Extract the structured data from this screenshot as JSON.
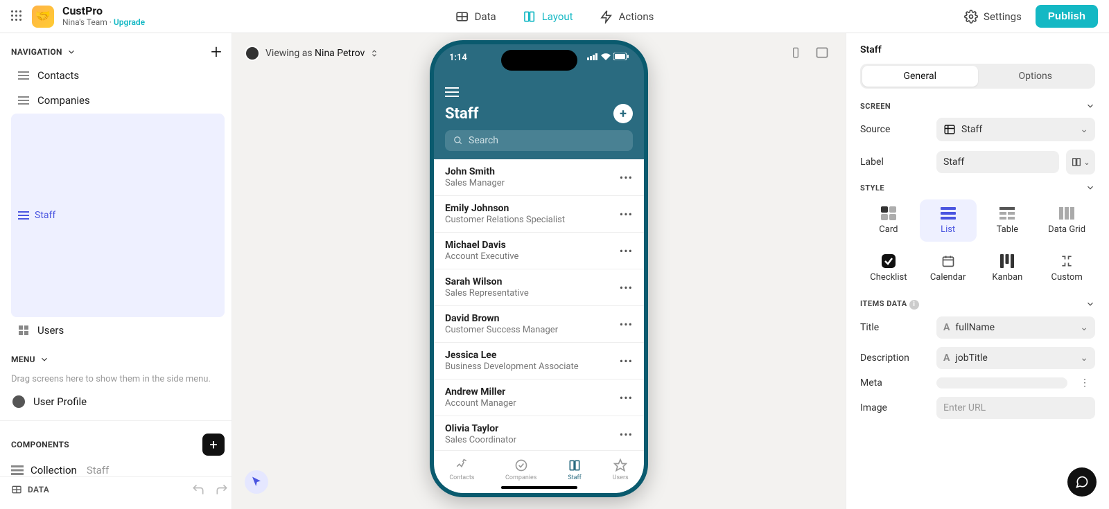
{
  "app": {
    "name": "CustPro",
    "team": "Nina's Team",
    "upgrade": "Upgrade"
  },
  "topTabs": {
    "data": "Data",
    "layout": "Layout",
    "actions": "Actions"
  },
  "topRight": {
    "settings": "Settings",
    "publish": "Publish"
  },
  "left": {
    "navHeader": "NAVIGATION",
    "navItems": [
      "Contacts",
      "Companies",
      "Staff",
      "Users"
    ],
    "menuHeader": "MENU",
    "menuHint": "Drag screens here to show them in the side menu.",
    "profile": "User Profile",
    "componentsHeader": "COMPONENTS",
    "component": {
      "label": "Collection",
      "sub": "Staff"
    },
    "data": "DATA"
  },
  "viewing": {
    "prefix": "Viewing as ",
    "name": "Nina Petrov"
  },
  "phone": {
    "time": "1:14",
    "title": "Staff",
    "searchPlaceholder": "Search",
    "items": [
      {
        "name": "John Smith",
        "role": "Sales Manager"
      },
      {
        "name": "Emily Johnson",
        "role": "Customer Relations Specialist"
      },
      {
        "name": "Michael Davis",
        "role": "Account Executive"
      },
      {
        "name": "Sarah Wilson",
        "role": "Sales Representative"
      },
      {
        "name": "David Brown",
        "role": "Customer Success Manager"
      },
      {
        "name": "Jessica Lee",
        "role": "Business Development Associate"
      },
      {
        "name": "Andrew Miller",
        "role": "Account Manager"
      },
      {
        "name": "Olivia Taylor",
        "role": "Sales Coordinator"
      }
    ],
    "tabs": [
      "Contacts",
      "Companies",
      "Staff",
      "Users"
    ]
  },
  "right": {
    "title": "Staff",
    "seg": {
      "general": "General",
      "options": "Options"
    },
    "screenHeader": "SCREEN",
    "source": {
      "label": "Source",
      "value": "Staff"
    },
    "labelRow": {
      "label": "Label",
      "value": "Staff"
    },
    "styleHeader": "STYLE",
    "styles": [
      "Card",
      "List",
      "Table",
      "Data Grid",
      "Checklist",
      "Calendar",
      "Kanban",
      "Custom"
    ],
    "itemsHeader": "ITEMS DATA",
    "titleRow": {
      "label": "Title",
      "value": "fullName"
    },
    "descRow": {
      "label": "Description",
      "value": "jobTitle"
    },
    "metaRow": {
      "label": "Meta"
    },
    "imageRow": {
      "label": "Image",
      "placeholder": "Enter URL"
    }
  }
}
